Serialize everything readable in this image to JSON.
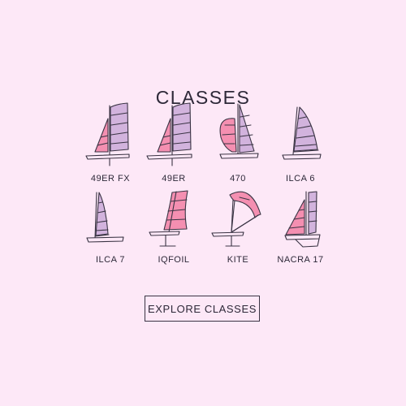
{
  "section": {
    "title": "CLASSES",
    "cta_label": "EXPLORE CLASSES"
  },
  "classes": [
    {
      "label": "49ER FX",
      "icon": "skiff-twin-sail-icon"
    },
    {
      "label": "49ER",
      "icon": "skiff-twin-sail-icon"
    },
    {
      "label": "470",
      "icon": "dinghy-spinnaker-icon"
    },
    {
      "label": "ILCA 6",
      "icon": "single-sail-dinghy-icon"
    },
    {
      "label": "ILCA 7",
      "icon": "single-sail-dinghy-icon"
    },
    {
      "label": "IQFOIL",
      "icon": "windfoil-icon"
    },
    {
      "label": "KITE",
      "icon": "kitefoil-icon"
    },
    {
      "label": "NACRA 17",
      "icon": "catamaran-icon"
    }
  ],
  "colors": {
    "background": "#fde8f7",
    "sail_purple": "#d2b3dd",
    "sail_pink": "#f48fb1",
    "ink": "#3a3444"
  }
}
